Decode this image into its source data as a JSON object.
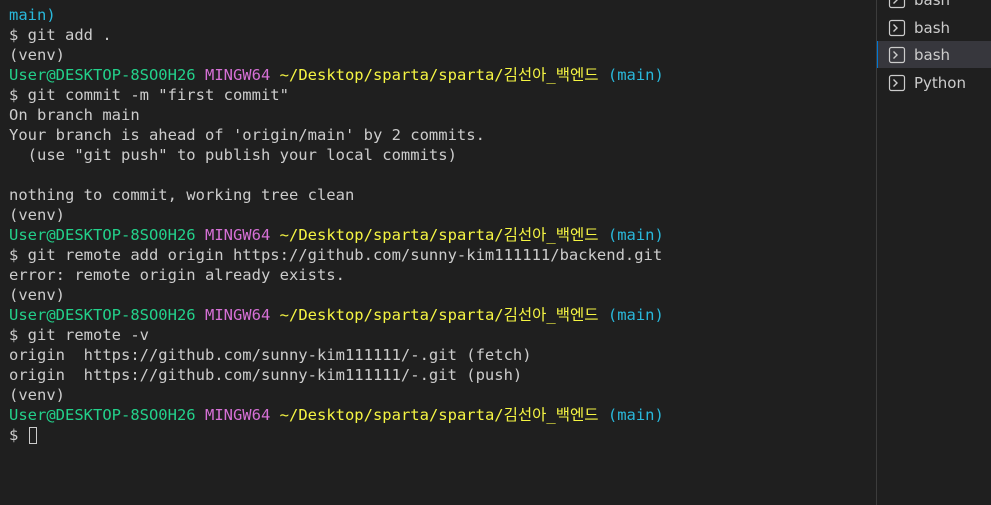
{
  "colors": {
    "background": "#1f1f1f",
    "text": "#cccccc",
    "user_host": "#23d18b",
    "mingw": "#d670d6",
    "path": "#f5f543",
    "branch": "#29b8db",
    "active_tab_bg": "#37373d",
    "active_tab_border": "#0078d4"
  },
  "terminal": {
    "lines": [
      [
        {
          "t": "main)",
          "c": "branch"
        }
      ],
      [
        {
          "t": "$ git add .",
          "c": "text"
        }
      ],
      [
        {
          "t": "(venv)",
          "c": "text"
        }
      ],
      [
        {
          "t": "User@DESKTOP-8SO0H26",
          "c": "user_host"
        },
        {
          "t": " ",
          "c": "text"
        },
        {
          "t": "MINGW64",
          "c": "mingw"
        },
        {
          "t": " ",
          "c": "text"
        },
        {
          "t": "~/Desktop/sparta/sparta/김선아_백엔드",
          "c": "path"
        },
        {
          "t": " ",
          "c": "text"
        },
        {
          "t": "(main)",
          "c": "branch"
        }
      ],
      [
        {
          "t": "$ git commit -m \"first commit\"",
          "c": "text"
        }
      ],
      [
        {
          "t": "On branch main",
          "c": "text"
        }
      ],
      [
        {
          "t": "Your branch is ahead of 'origin/main' by 2 commits.",
          "c": "text"
        }
      ],
      [
        {
          "t": "  (use \"git push\" to publish your local commits)",
          "c": "text"
        }
      ],
      [
        {
          "t": "",
          "c": "text"
        }
      ],
      [
        {
          "t": "nothing to commit, working tree clean",
          "c": "text"
        }
      ],
      [
        {
          "t": "(venv)",
          "c": "text"
        }
      ],
      [
        {
          "t": "User@DESKTOP-8SO0H26",
          "c": "user_host"
        },
        {
          "t": " ",
          "c": "text"
        },
        {
          "t": "MINGW64",
          "c": "mingw"
        },
        {
          "t": " ",
          "c": "text"
        },
        {
          "t": "~/Desktop/sparta/sparta/김선아_백엔드",
          "c": "path"
        },
        {
          "t": " ",
          "c": "text"
        },
        {
          "t": "(main)",
          "c": "branch"
        }
      ],
      [
        {
          "t": "$ git remote add origin https://github.com/sunny-kim111111/backend.git",
          "c": "text"
        }
      ],
      [
        {
          "t": "error: remote origin already exists.",
          "c": "text"
        }
      ],
      [
        {
          "t": "(venv)",
          "c": "text"
        }
      ],
      [
        {
          "t": "User@DESKTOP-8SO0H26",
          "c": "user_host"
        },
        {
          "t": " ",
          "c": "text"
        },
        {
          "t": "MINGW64",
          "c": "mingw"
        },
        {
          "t": " ",
          "c": "text"
        },
        {
          "t": "~/Desktop/sparta/sparta/김선아_백엔드",
          "c": "path"
        },
        {
          "t": " ",
          "c": "text"
        },
        {
          "t": "(main)",
          "c": "branch"
        }
      ],
      [
        {
          "t": "$ git remote -v",
          "c": "text"
        }
      ],
      [
        {
          "t": "origin  https://github.com/sunny-kim111111/-.git (fetch)",
          "c": "text"
        }
      ],
      [
        {
          "t": "origin  https://github.com/sunny-kim111111/-.git (push)",
          "c": "text"
        }
      ],
      [
        {
          "t": "(venv)",
          "c": "text"
        }
      ],
      [
        {
          "t": "User@DESKTOP-8SO0H26",
          "c": "user_host"
        },
        {
          "t": " ",
          "c": "text"
        },
        {
          "t": "MINGW64",
          "c": "mingw"
        },
        {
          "t": " ",
          "c": "text"
        },
        {
          "t": "~/Desktop/sparta/sparta/김선아_백엔드",
          "c": "path"
        },
        {
          "t": " ",
          "c": "text"
        },
        {
          "t": "(main)",
          "c": "branch"
        }
      ],
      [
        {
          "t": "$ ",
          "c": "text"
        }
      ]
    ],
    "cursor_line": 21
  },
  "tabs": [
    {
      "label": "bash",
      "icon": "terminal-icon",
      "active": false
    },
    {
      "label": "bash",
      "icon": "terminal-icon",
      "active": false
    },
    {
      "label": "bash",
      "icon": "terminal-icon",
      "active": true
    },
    {
      "label": "Python",
      "icon": "terminal-icon",
      "active": false
    }
  ]
}
